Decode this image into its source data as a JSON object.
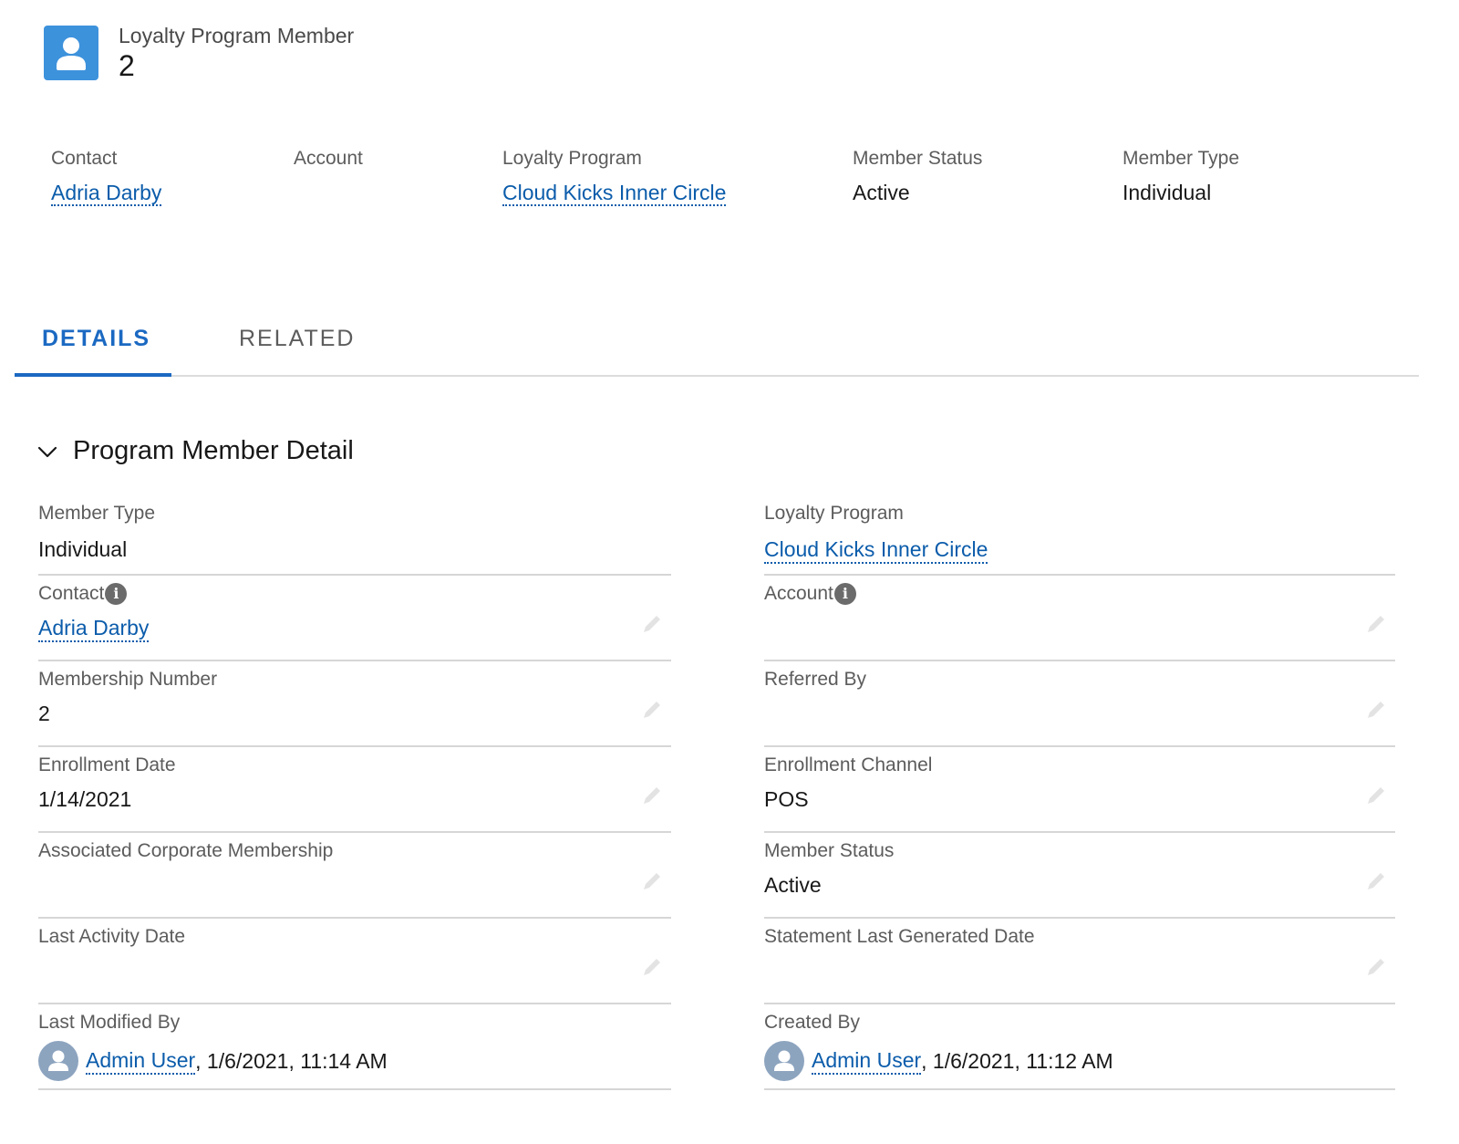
{
  "record": {
    "object_type": "Loyalty Program Member",
    "name": "2",
    "icon": "user-icon",
    "icon_color": "#3d92dc"
  },
  "highlights": [
    {
      "label": "Contact",
      "value": "Adria Darby",
      "is_link": true
    },
    {
      "label": "Account",
      "value": "",
      "is_link": false
    },
    {
      "label": "Loyalty Program",
      "value": "Cloud Kicks Inner Circle",
      "is_link": true
    },
    {
      "label": "Member Status",
      "value": "Active",
      "is_link": false
    },
    {
      "label": "Member Type",
      "value": "Individual",
      "is_link": false
    }
  ],
  "tabs": [
    {
      "label": "DETAILS",
      "active": true
    },
    {
      "label": "RELATED",
      "active": false
    }
  ],
  "section": {
    "title": "Program Member Detail",
    "expanded": true,
    "left_fields": [
      {
        "label": "Member Type",
        "value": "Individual",
        "editable": false
      },
      {
        "label": "Contact",
        "value": "Adria Darby",
        "is_link": true,
        "info": true,
        "editable": true
      },
      {
        "label": "Membership Number",
        "value": "2",
        "editable": true
      },
      {
        "label": "Enrollment Date",
        "value": "1/14/2021",
        "editable": true
      },
      {
        "label": "Associated Corporate Membership",
        "value": "",
        "editable": true
      },
      {
        "label": "Last Activity Date",
        "value": "",
        "editable": true
      },
      {
        "label": "Last Modified By",
        "user": "Admin User",
        "timestamp": ", 1/6/2021, 11:14 AM",
        "editable": false
      }
    ],
    "right_fields": [
      {
        "label": "Loyalty Program",
        "value": "Cloud Kicks Inner Circle",
        "is_link": true,
        "editable": false
      },
      {
        "label": "Account",
        "value": "",
        "info": true,
        "editable": true
      },
      {
        "label": "Referred By",
        "value": "",
        "editable": true
      },
      {
        "label": "Enrollment Channel",
        "value": "POS",
        "editable": true
      },
      {
        "label": "Member Status",
        "value": "Active",
        "editable": true
      },
      {
        "label": "Statement Last Generated Date",
        "value": "",
        "editable": true
      },
      {
        "label": "Created By",
        "user": "Admin User",
        "timestamp": ", 1/6/2021, 11:12 AM",
        "editable": false
      }
    ]
  },
  "colors": {
    "link": "#0b5cab",
    "active_tab": "#1b69c2",
    "avatar_bg": "#8da4bf"
  }
}
